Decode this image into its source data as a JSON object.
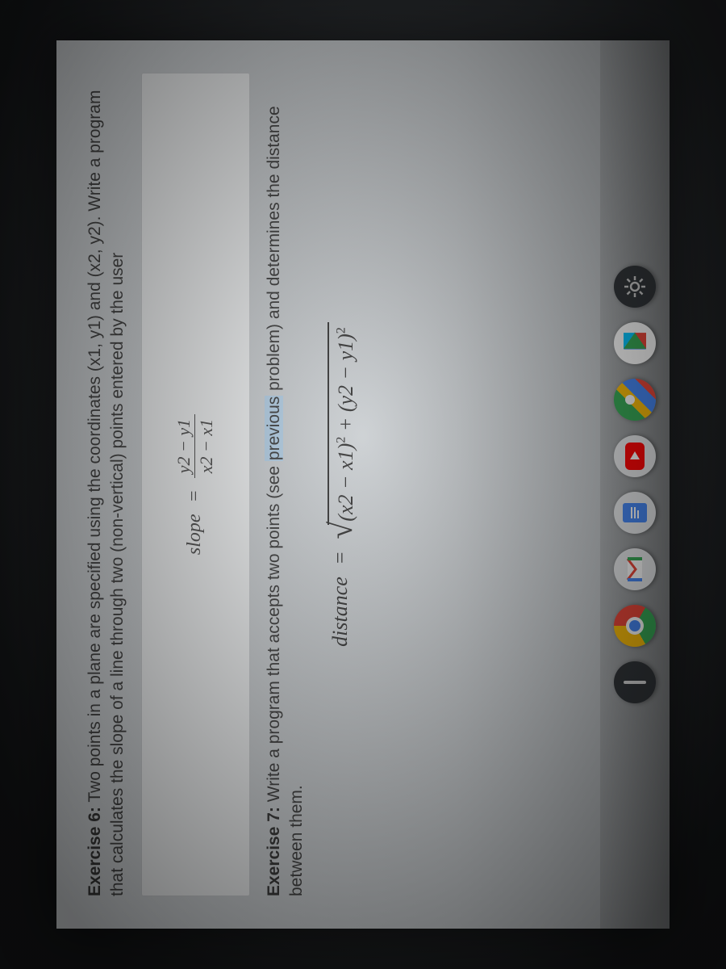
{
  "exercise6": {
    "label": "Exercise 6:",
    "text": "Two points in a plane are specified using the coordinates (x1, y1) and (x2, y2). Write a program that calculates the slope of a line through two (non-vertical) points entered by the user"
  },
  "slope_formula": {
    "lhs": "slope",
    "eq": "=",
    "num": "y2 − y1",
    "den": "x2 − x1"
  },
  "exercise7": {
    "label": "Exercise 7:",
    "text_before": "Write a program that accepts two points (see ",
    "highlight": "previous",
    "text_after": " problem) and determines the distance between them."
  },
  "distance_formula": {
    "lhs": "distance",
    "eq": "=",
    "radicand": "(x2 − x1)",
    "plus": " + ",
    "radicand2": "(y2 − y1)",
    "sup": "2"
  },
  "shelf": {
    "items": [
      "chrome",
      "gmail",
      "docs",
      "youtube",
      "maps",
      "play",
      "settings"
    ]
  }
}
